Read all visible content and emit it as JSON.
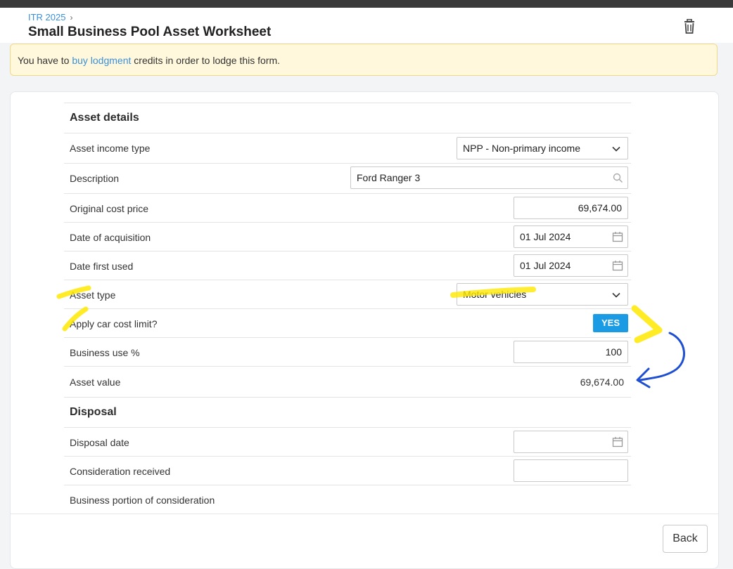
{
  "header": {
    "breadcrumb": "ITR 2025",
    "breadcrumb_separator": "›",
    "title": "Small Business Pool Asset Worksheet",
    "delete_icon": "trash-icon"
  },
  "notice": {
    "text_before": "You have to ",
    "link_text": "buy lodgment",
    "text_after": " credits in order to lodge this form."
  },
  "asset_details": {
    "section_title": "Asset details",
    "income_type": {
      "label": "Asset income type",
      "value": "NPP - Non-primary income"
    },
    "description": {
      "label": "Description",
      "value": "Ford Ranger 3"
    },
    "original_cost": {
      "label": "Original cost price",
      "value": "69,674.00"
    },
    "date_acquired": {
      "label": "Date of acquisition",
      "value": "01 Jul 2024"
    },
    "date_first_used": {
      "label": "Date first used",
      "value": "01 Jul 2024"
    },
    "asset_type": {
      "label": "Asset type",
      "value": "Motor vehicles"
    },
    "car_cost_limit": {
      "label": "Apply car cost limit?",
      "value": "YES"
    },
    "business_use": {
      "label": "Business use %",
      "value": "100"
    },
    "asset_value": {
      "label": "Asset value",
      "value": "69,674.00"
    }
  },
  "disposal": {
    "section_title": "Disposal",
    "disposal_date": {
      "label": "Disposal date",
      "value": ""
    },
    "consideration_received": {
      "label": "Consideration received",
      "value": ""
    },
    "business_portion": {
      "label": "Business portion of consideration"
    }
  },
  "footer": {
    "back_label": "Back"
  },
  "colors": {
    "accent": "#1a9be3",
    "link": "#3b8fd9",
    "highlight": "#ffe800",
    "annotation_arrow": "#1f4fd1",
    "notice_bg": "#fff8dc"
  }
}
